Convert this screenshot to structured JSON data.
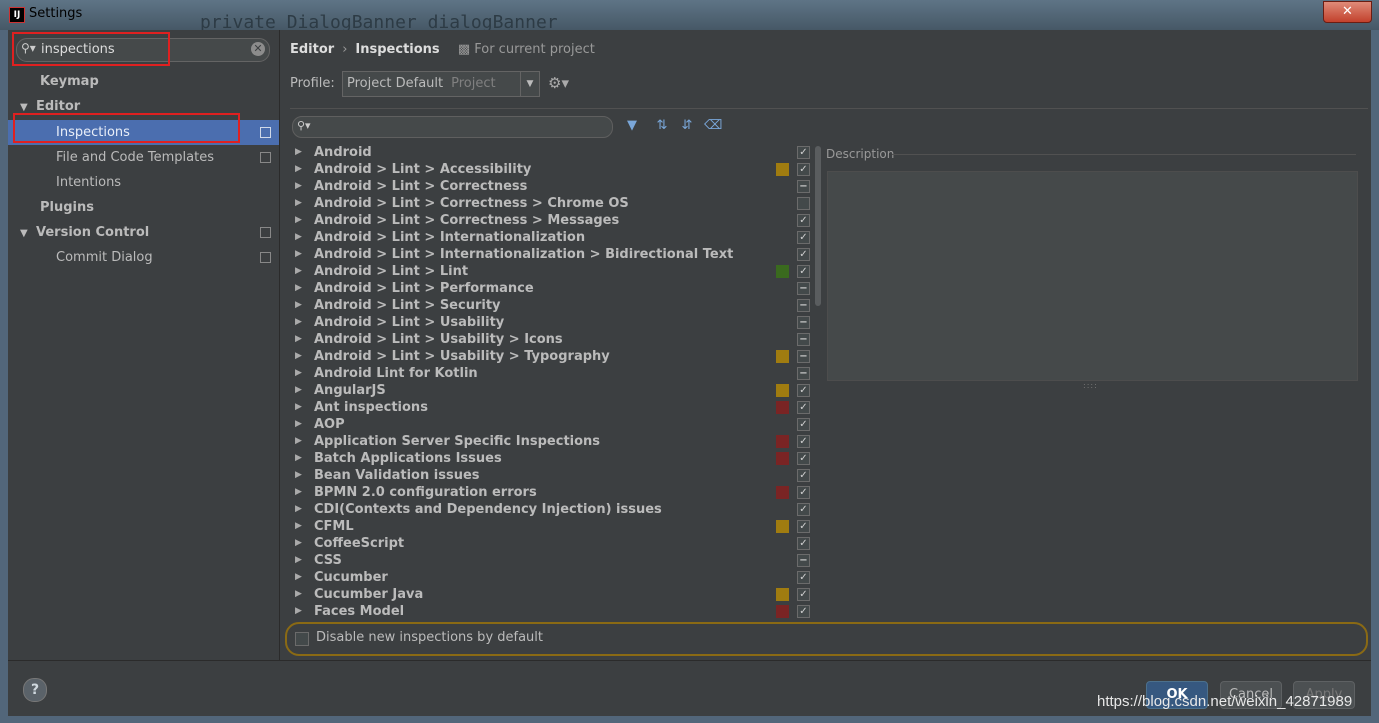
{
  "window": {
    "title": "Settings",
    "app_icon_text": "IJ",
    "background_code": "private DialogBanner dialogBanner",
    "close_glyph": "✕"
  },
  "sidebar": {
    "search_value": "inspections",
    "items": [
      {
        "label": "Keymap"
      },
      {
        "label": "Editor",
        "arrow": "▼"
      },
      {
        "label": "Inspections"
      },
      {
        "label": "File and Code Templates"
      },
      {
        "label": "Intentions"
      },
      {
        "label": "Plugins"
      },
      {
        "label": "Version Control",
        "arrow": "▼"
      },
      {
        "label": "Commit Dialog"
      }
    ]
  },
  "content": {
    "breadcrumb": {
      "root": "Editor",
      "separator": "›",
      "current": "Inspections",
      "scope": "For current project"
    },
    "profile": {
      "label": "Profile:",
      "value": "Project Default",
      "hint": "Project"
    },
    "description_label": "Description",
    "disable_label": "Disable new inspections by default",
    "rows": [
      {
        "label": "Android",
        "sev": "",
        "check": "✓"
      },
      {
        "label": "Android > Lint > Accessibility",
        "sev": "#a07c10",
        "check": "✓"
      },
      {
        "label": "Android > Lint > Correctness",
        "sev": "",
        "check": "−"
      },
      {
        "label": "Android > Lint > Correctness > Chrome OS",
        "sev": "",
        "check": ""
      },
      {
        "label": "Android > Lint > Correctness > Messages",
        "sev": "",
        "check": "✓"
      },
      {
        "label": "Android > Lint > Internationalization",
        "sev": "",
        "check": "✓"
      },
      {
        "label": "Android > Lint > Internationalization > Bidirectional Text",
        "sev": "",
        "check": "✓"
      },
      {
        "label": "Android > Lint > Lint",
        "sev": "#3a6a1e",
        "check": "✓"
      },
      {
        "label": "Android > Lint > Performance",
        "sev": "",
        "check": "−"
      },
      {
        "label": "Android > Lint > Security",
        "sev": "",
        "check": "−"
      },
      {
        "label": "Android > Lint > Usability",
        "sev": "",
        "check": "−"
      },
      {
        "label": "Android > Lint > Usability > Icons",
        "sev": "",
        "check": "−"
      },
      {
        "label": "Android > Lint > Usability > Typography",
        "sev": "#a07c10",
        "check": "−"
      },
      {
        "label": "Android Lint for Kotlin",
        "sev": "",
        "check": "−"
      },
      {
        "label": "AngularJS",
        "sev": "#a07c10",
        "check": "✓"
      },
      {
        "label": "Ant inspections",
        "sev": "#7a2424",
        "check": "✓"
      },
      {
        "label": "AOP",
        "sev": "",
        "check": "✓"
      },
      {
        "label": "Application Server Specific Inspections",
        "sev": "#7a2424",
        "check": "✓"
      },
      {
        "label": "Batch Applications Issues",
        "sev": "#7a2424",
        "check": "✓"
      },
      {
        "label": "Bean Validation issues",
        "sev": "",
        "check": "✓"
      },
      {
        "label": "BPMN 2.0 configuration errors",
        "sev": "#7a2424",
        "check": "✓"
      },
      {
        "label": "CDI(Contexts and Dependency Injection) issues",
        "sev": "",
        "check": "✓"
      },
      {
        "label": "CFML",
        "sev": "#a07c10",
        "check": "✓"
      },
      {
        "label": "CoffeeScript",
        "sev": "",
        "check": "✓"
      },
      {
        "label": "CSS",
        "sev": "",
        "check": "−"
      },
      {
        "label": "Cucumber",
        "sev": "",
        "check": "✓"
      },
      {
        "label": "Cucumber Java",
        "sev": "#a07c10",
        "check": "✓"
      },
      {
        "label": "Faces Model",
        "sev": "#7a2424",
        "check": "✓"
      }
    ]
  },
  "footer": {
    "help": "?",
    "ok": "OK",
    "cancel": "Cancel",
    "apply": "Apply"
  },
  "watermark": "https://blog.csdn.net/weixin_42871989"
}
